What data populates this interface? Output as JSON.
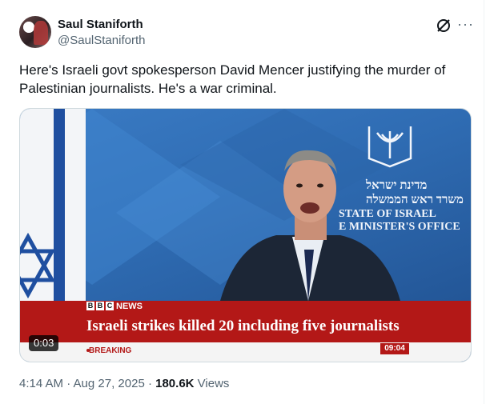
{
  "author": {
    "display_name": "Saul Staniforth",
    "handle": "@SaulStaniforth"
  },
  "tweet": {
    "text_line1": "Here's Israeli govt spokesperson David Mencer justifying the murder of",
    "text_line2": "Palestinian journalists. He's a war criminal."
  },
  "icons": {
    "grok": "grok-icon",
    "more": "more-icon"
  },
  "more_glyph": "···",
  "video": {
    "duration": "0:03",
    "seal_hebrew_1": "מדינת ישראל",
    "seal_hebrew_2": "משרד ראש הממשלה",
    "seal_state": "STATE OF ISRAEL",
    "seal_office": "E MINISTER'S OFFICE",
    "bbc_letters": [
      "B",
      "B",
      "C"
    ],
    "news_label": "NEWS",
    "headline": "Israeli strikes killed 20 including five journalists",
    "breaking": "BREAKING",
    "clock": "09:04"
  },
  "meta": {
    "time_date": "4:14 AM · Aug 27, 2025 · ",
    "views_count": "180.6K",
    "views_label": " Views"
  },
  "colors": {
    "text": "#0f1419",
    "secondary": "#536471",
    "bbc_red": "#b31817",
    "backdrop_blue": "#2f6cb3"
  }
}
